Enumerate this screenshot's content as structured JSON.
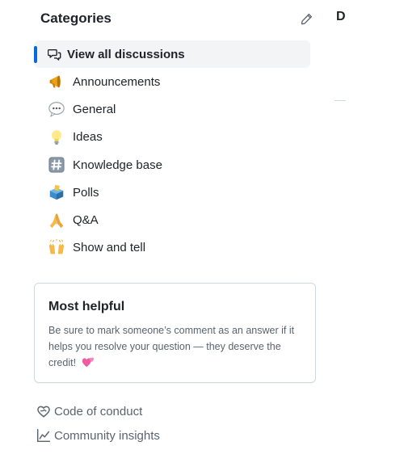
{
  "categories": {
    "title": "Categories",
    "items": [
      {
        "label": "View all discussions",
        "icon": "comment-discussion-icon",
        "selected": true
      },
      {
        "label": "Announcements",
        "icon": "megaphone-icon"
      },
      {
        "label": "General",
        "icon": "speech-balloon-icon"
      },
      {
        "label": "Ideas",
        "icon": "light-bulb-icon"
      },
      {
        "label": "Knowledge base",
        "icon": "hash-keycap-icon"
      },
      {
        "label": "Polls",
        "icon": "ballot-box-icon"
      },
      {
        "label": "Q&A",
        "icon": "folded-hands-icon"
      },
      {
        "label": "Show and tell",
        "icon": "raising-hands-icon"
      }
    ]
  },
  "right_panel": {
    "heading_initial": "D"
  },
  "most_helpful": {
    "title": "Most helpful",
    "body": "Be sure to mark someone’s comment as an answer if it helps you resolve your question — they deserve the credit!",
    "emoji": "two-hearts-icon"
  },
  "footer": {
    "code_of_conduct": "Code of conduct",
    "community_insights": "Community insights"
  },
  "colors": {
    "accent": "#0969da",
    "selected_bg": "#f3f4f6",
    "muted_text": "#59636e",
    "border": "#d0d7de"
  }
}
